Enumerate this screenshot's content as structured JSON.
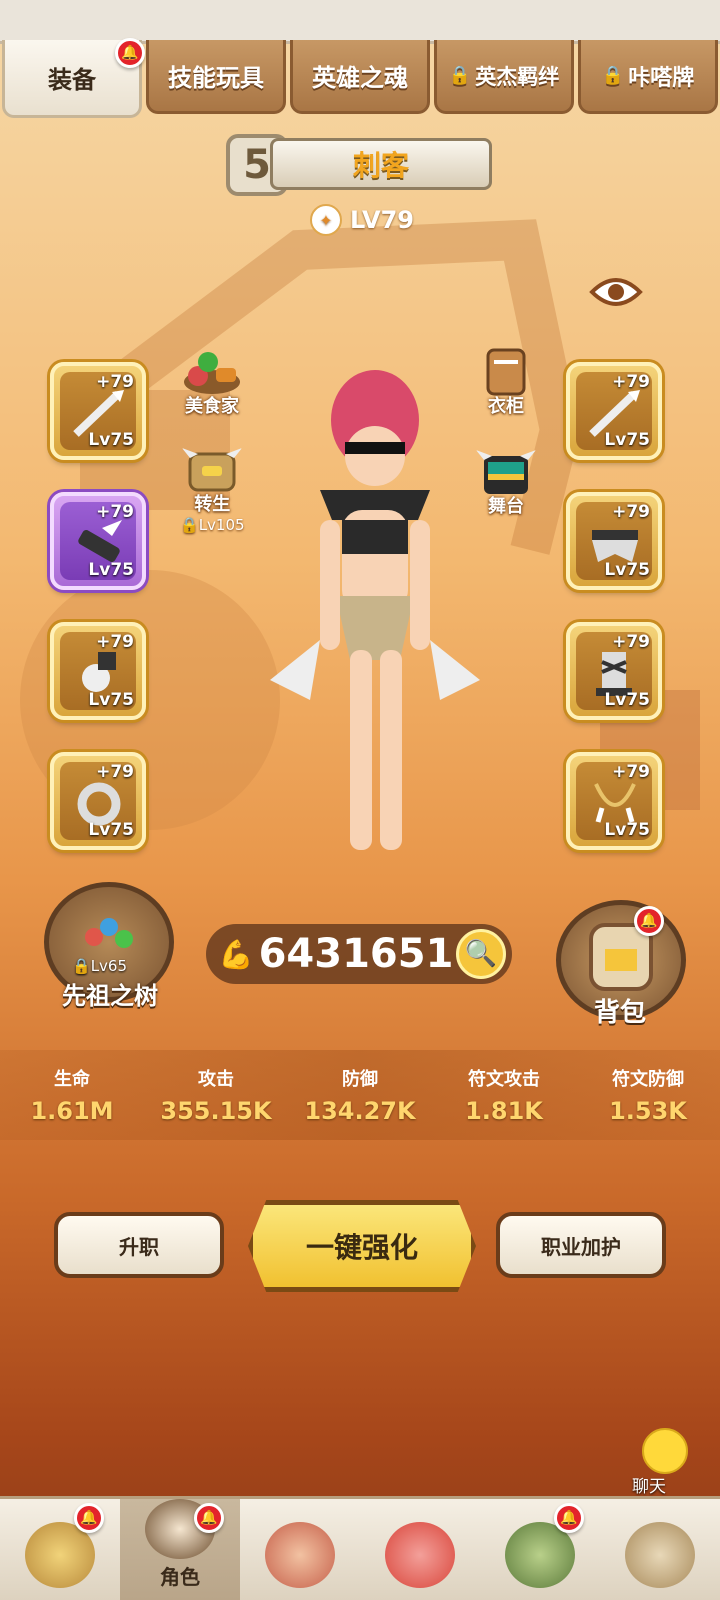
{
  "tabs": [
    {
      "label": "装备",
      "locked": false,
      "active": true,
      "badge": true
    },
    {
      "label": "技能玩具",
      "locked": false,
      "active": false,
      "badge": false
    },
    {
      "label": "英雄之魂",
      "locked": false,
      "active": false,
      "badge": false
    },
    {
      "label": "英杰羁绊",
      "locked": true,
      "active": false,
      "badge": false
    },
    {
      "label": "咔嗒牌",
      "locked": true,
      "active": false,
      "badge": false
    }
  ],
  "hero": {
    "rank": "5",
    "class_name": "刺客",
    "level": "LV79"
  },
  "left_slots": [
    {
      "plus": "+79",
      "lv": "Lv75",
      "rarity": "gold"
    },
    {
      "plus": "+79",
      "lv": "Lv75",
      "rarity": "purple"
    },
    {
      "plus": "+79",
      "lv": "Lv75",
      "rarity": "gold"
    },
    {
      "plus": "+79",
      "lv": "Lv75",
      "rarity": "gold"
    }
  ],
  "right_slots": [
    {
      "plus": "+79",
      "lv": "Lv75",
      "rarity": "gold"
    },
    {
      "plus": "+79",
      "lv": "Lv75",
      "rarity": "gold"
    },
    {
      "plus": "+79",
      "lv": "Lv75",
      "rarity": "gold"
    },
    {
      "plus": "+79",
      "lv": "Lv75",
      "rarity": "gold"
    }
  ],
  "features": {
    "gourmet": "美食家",
    "rebirth": "转生",
    "rebirth_lock": "Lv105",
    "wardrobe": "衣柜",
    "stage": "舞台"
  },
  "ancestor_tree": {
    "label": "先祖之树",
    "lock": "Lv65"
  },
  "power": "6431651",
  "bag": {
    "label": "背包",
    "badge": true
  },
  "stats": [
    {
      "name": "生命",
      "value": "1.61M"
    },
    {
      "name": "攻击",
      "value": "355.15K"
    },
    {
      "name": "防御",
      "value": "134.27K"
    },
    {
      "name": "符文攻击",
      "value": "1.81K"
    },
    {
      "name": "符文防御",
      "value": "1.53K"
    }
  ],
  "buttons": {
    "promote": "升职",
    "enhance": "一键强化",
    "class_bonus": "职业加护"
  },
  "chat": "聊天",
  "bottom_nav": [
    {
      "label": "",
      "badge": true,
      "active": false
    },
    {
      "label": "角色",
      "badge": true,
      "active": true
    },
    {
      "label": "",
      "badge": false,
      "active": false
    },
    {
      "label": "",
      "badge": false,
      "active": false
    },
    {
      "label": "",
      "badge": true,
      "active": false
    },
    {
      "label": "",
      "badge": false,
      "active": false
    }
  ],
  "colors": {
    "accent_gold": "#f5c53b",
    "purple_rarity": "#a96ad6",
    "badge_red": "#e3242b"
  }
}
